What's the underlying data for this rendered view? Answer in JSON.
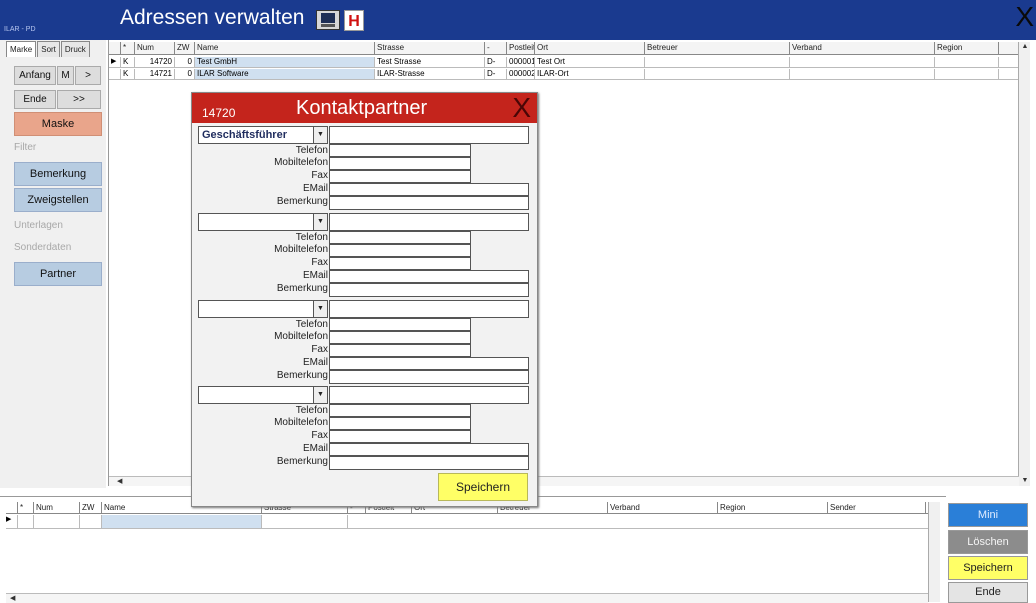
{
  "app": {
    "label": "ILAR - PD",
    "title": "Adressen verwalten",
    "h_letter": "H",
    "close_glyph": "X"
  },
  "sidebar": {
    "tabs": [
      "Marke",
      "Sort",
      "Druck"
    ],
    "nav": {
      "anfang": "Anfang",
      "m": "M",
      "next": ">",
      "ende": "Ende",
      "last": ">>"
    },
    "maske": "Maske",
    "filter_label": "Filter",
    "bemerkung": "Bemerkung",
    "zweigstellen": "Zweigstellen",
    "unterlagen_label": "Unterlagen",
    "sonderdaten_label": "Sonderdaten",
    "partner": "Partner"
  },
  "grid": {
    "columns": [
      "*",
      "Num",
      "ZW",
      "Name",
      "Strasse",
      "-",
      "Postleit",
      "Ort",
      "Betreuer",
      "Verband",
      "Region"
    ],
    "rows": [
      {
        "mark": "K",
        "num": "14720",
        "zw": "0",
        "name": "Test GmbH",
        "strasse": "Test Strasse",
        "land": "D-",
        "plz": "000001",
        "ort": "Test Ort"
      },
      {
        "mark": "K",
        "num": "14721",
        "zw": "0",
        "name": "ILAR Software",
        "strasse": "ILAR-Strasse",
        "land": "D-",
        "plz": "000002",
        "ort": "ILAR-Ort"
      }
    ]
  },
  "bottom_grid": {
    "columns": [
      "*",
      "Num",
      "ZW",
      "Name",
      "Strasse",
      "-",
      "Postleit",
      "Ort",
      "Betreuer",
      "Verband",
      "Region",
      "Sender"
    ]
  },
  "right_buttons": {
    "mini": "Mini",
    "loeschen": "Löschen",
    "speichern": "Speichern",
    "ende": "Ende"
  },
  "dialog": {
    "number": "14720",
    "title": "Kontaktpartner",
    "close_glyph": "X",
    "field_labels": {
      "telefon": "Telefon",
      "mobil": "Mobiltelefon",
      "fax": "Fax",
      "email": "EMail",
      "bemerkung": "Bemerkung"
    },
    "blocks": [
      {
        "role": "Geschäftsführer"
      },
      {
        "role": ""
      },
      {
        "role": ""
      },
      {
        "role": ""
      }
    ],
    "save_label": "Speichern"
  },
  "colors": {
    "titlebar": "#1a3a8f",
    "dialog_header": "#c4241c",
    "maske_button": "#e9a58b",
    "side_button": "#b7cce1",
    "save_button": "#ffff66",
    "mini_button": "#2a7fd8"
  }
}
